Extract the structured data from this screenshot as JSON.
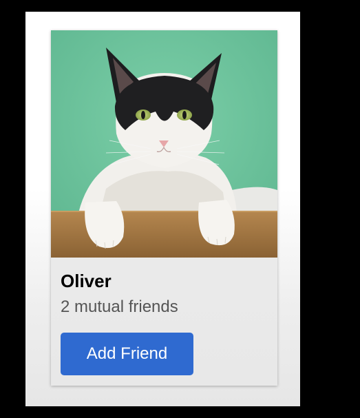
{
  "card": {
    "name": "Oliver",
    "mutual_friends": "2 mutual friends",
    "add_friend_label": "Add Friend",
    "photo_subject": "black-and-white-cat"
  },
  "colors": {
    "button_bg": "#2f6ad0",
    "button_text": "#ffffff",
    "photo_background": "#6cc4a0",
    "ledge": "#a77b45"
  }
}
